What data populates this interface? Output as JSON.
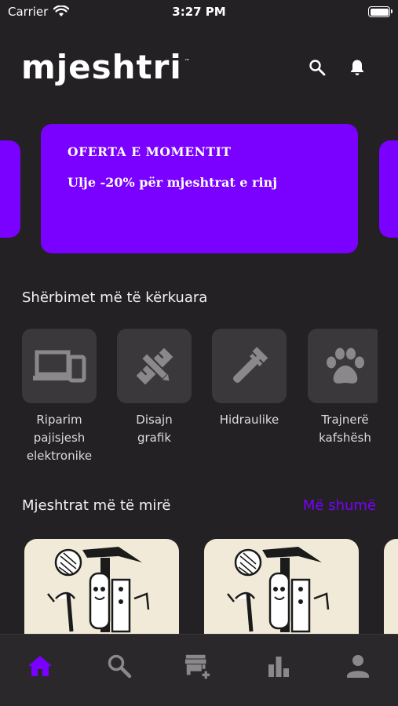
{
  "status_bar": {
    "carrier": "Carrier",
    "time": "3:27 PM"
  },
  "header": {
    "logo_text": "mjeshtri",
    "logo_tm": "™",
    "search_icon": "search-icon",
    "bell_icon": "bell-icon"
  },
  "banner": {
    "title": "OFERTA E MOMENTIT",
    "subtitle": "Ulje -20% për mjeshtrat e rinj"
  },
  "services_section": {
    "title": "Shërbimet më të kërkuara",
    "items": [
      {
        "line1": "Riparim",
        "line2": "pajisjesh",
        "line3": "elektronike",
        "icon": "devices-icon"
      },
      {
        "line1": "Disajn",
        "line2": "grafik",
        "icon": "design-tools-icon"
      },
      {
        "line1": "Hidraulike",
        "icon": "pipe-wrench-icon"
      },
      {
        "line1": "Trajnerë",
        "line2": "kafshësh",
        "icon": "paw-icon"
      }
    ]
  },
  "masters_section": {
    "title": "Mjeshtrat më të mirë",
    "more_label": "Më shumë"
  },
  "tabbar": {
    "icons": [
      "home-icon",
      "search-icon",
      "add-store-icon",
      "stats-icon",
      "profile-icon"
    ]
  },
  "colors": {
    "accent": "#7a00ff",
    "background": "#232124",
    "tile": "#3a383b",
    "card": "#f1ead9",
    "icon_gray": "#8a888b"
  }
}
